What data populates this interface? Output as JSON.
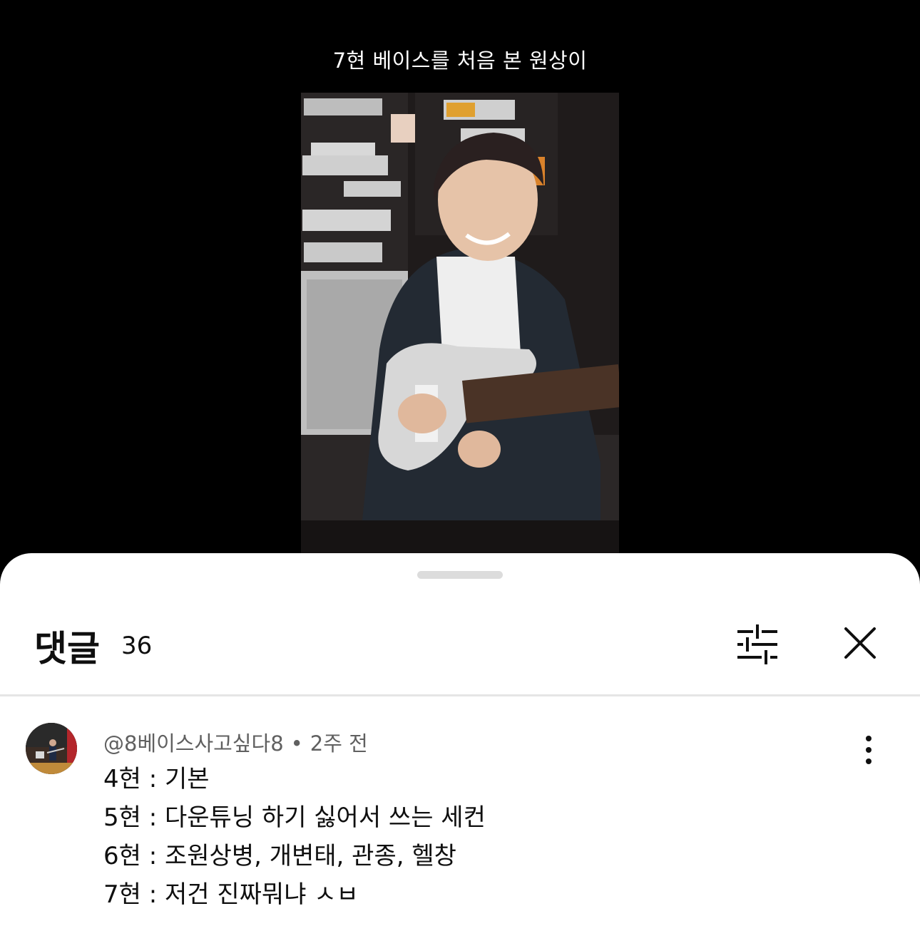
{
  "video": {
    "title": "7현 베이스를 처음 본 원상이"
  },
  "comments_panel": {
    "title": "댓글",
    "count": "36",
    "icons": {
      "filter": "sliders-icon",
      "close": "close-icon",
      "more": "more-vertical-icon"
    },
    "comments": [
      {
        "author": "@8베이스사고싶다8",
        "separator": "•",
        "time": "2주 전",
        "lines": [
          "4현 : 기본",
          "5현 : 다운튜닝 하기 싫어서 쓰는 세컨",
          "6현 : 조원상병, 개변태, 관종, 헬창",
          "7현 : 저건 진짜뭐냐 ㅅㅂ"
        ]
      }
    ]
  }
}
